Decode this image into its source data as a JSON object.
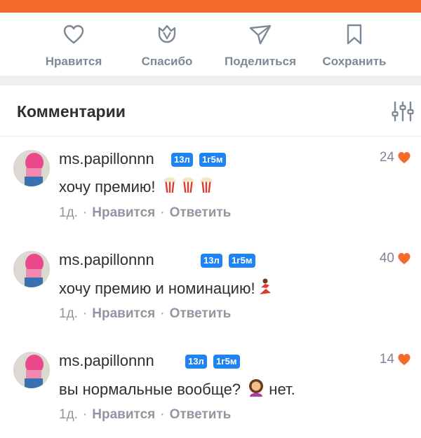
{
  "actions": [
    {
      "label": "Нравится",
      "icon": "heart-outline-icon"
    },
    {
      "label": "Спасибо",
      "icon": "tulip-icon"
    },
    {
      "label": "Поделиться",
      "icon": "paper-plane-icon"
    },
    {
      "label": "Сохранить",
      "icon": "bookmark-icon"
    }
  ],
  "comments_section": {
    "title": "Комментарии",
    "filter_icon": "sliders-filter-icon"
  },
  "comments": [
    {
      "author": "ms.papillonnn",
      "badge_age": "13л",
      "badge_time": "1г5м",
      "likes": "24",
      "text": "хочу премию!",
      "emojis": [
        "popcorn",
        "popcorn",
        "popcorn"
      ],
      "time": "1д.",
      "like_link": "Нравится",
      "reply_link": "Ответить"
    },
    {
      "author": "ms.papillonnn",
      "badge_age": "13л",
      "badge_time": "1г5м",
      "likes": "40",
      "text": "хочу премию и номинацию!",
      "emojis": [
        "dancer"
      ],
      "time": "1д.",
      "like_link": "Нравится",
      "reply_link": "Ответить"
    },
    {
      "author": "ms.papillonnn",
      "badge_age": "13л",
      "badge_time": "1г5м",
      "likes": "14",
      "text": "вы нормальные вообще?",
      "text_after": "нет.",
      "emojis": [
        "woman"
      ],
      "time": "1д.",
      "like_link": "Нравится",
      "reply_link": "Ответить"
    }
  ],
  "colors": {
    "accent": "#f26a2c",
    "badge": "#1d84f2",
    "heart": "#f26a2c",
    "muted": "#7d8896"
  }
}
